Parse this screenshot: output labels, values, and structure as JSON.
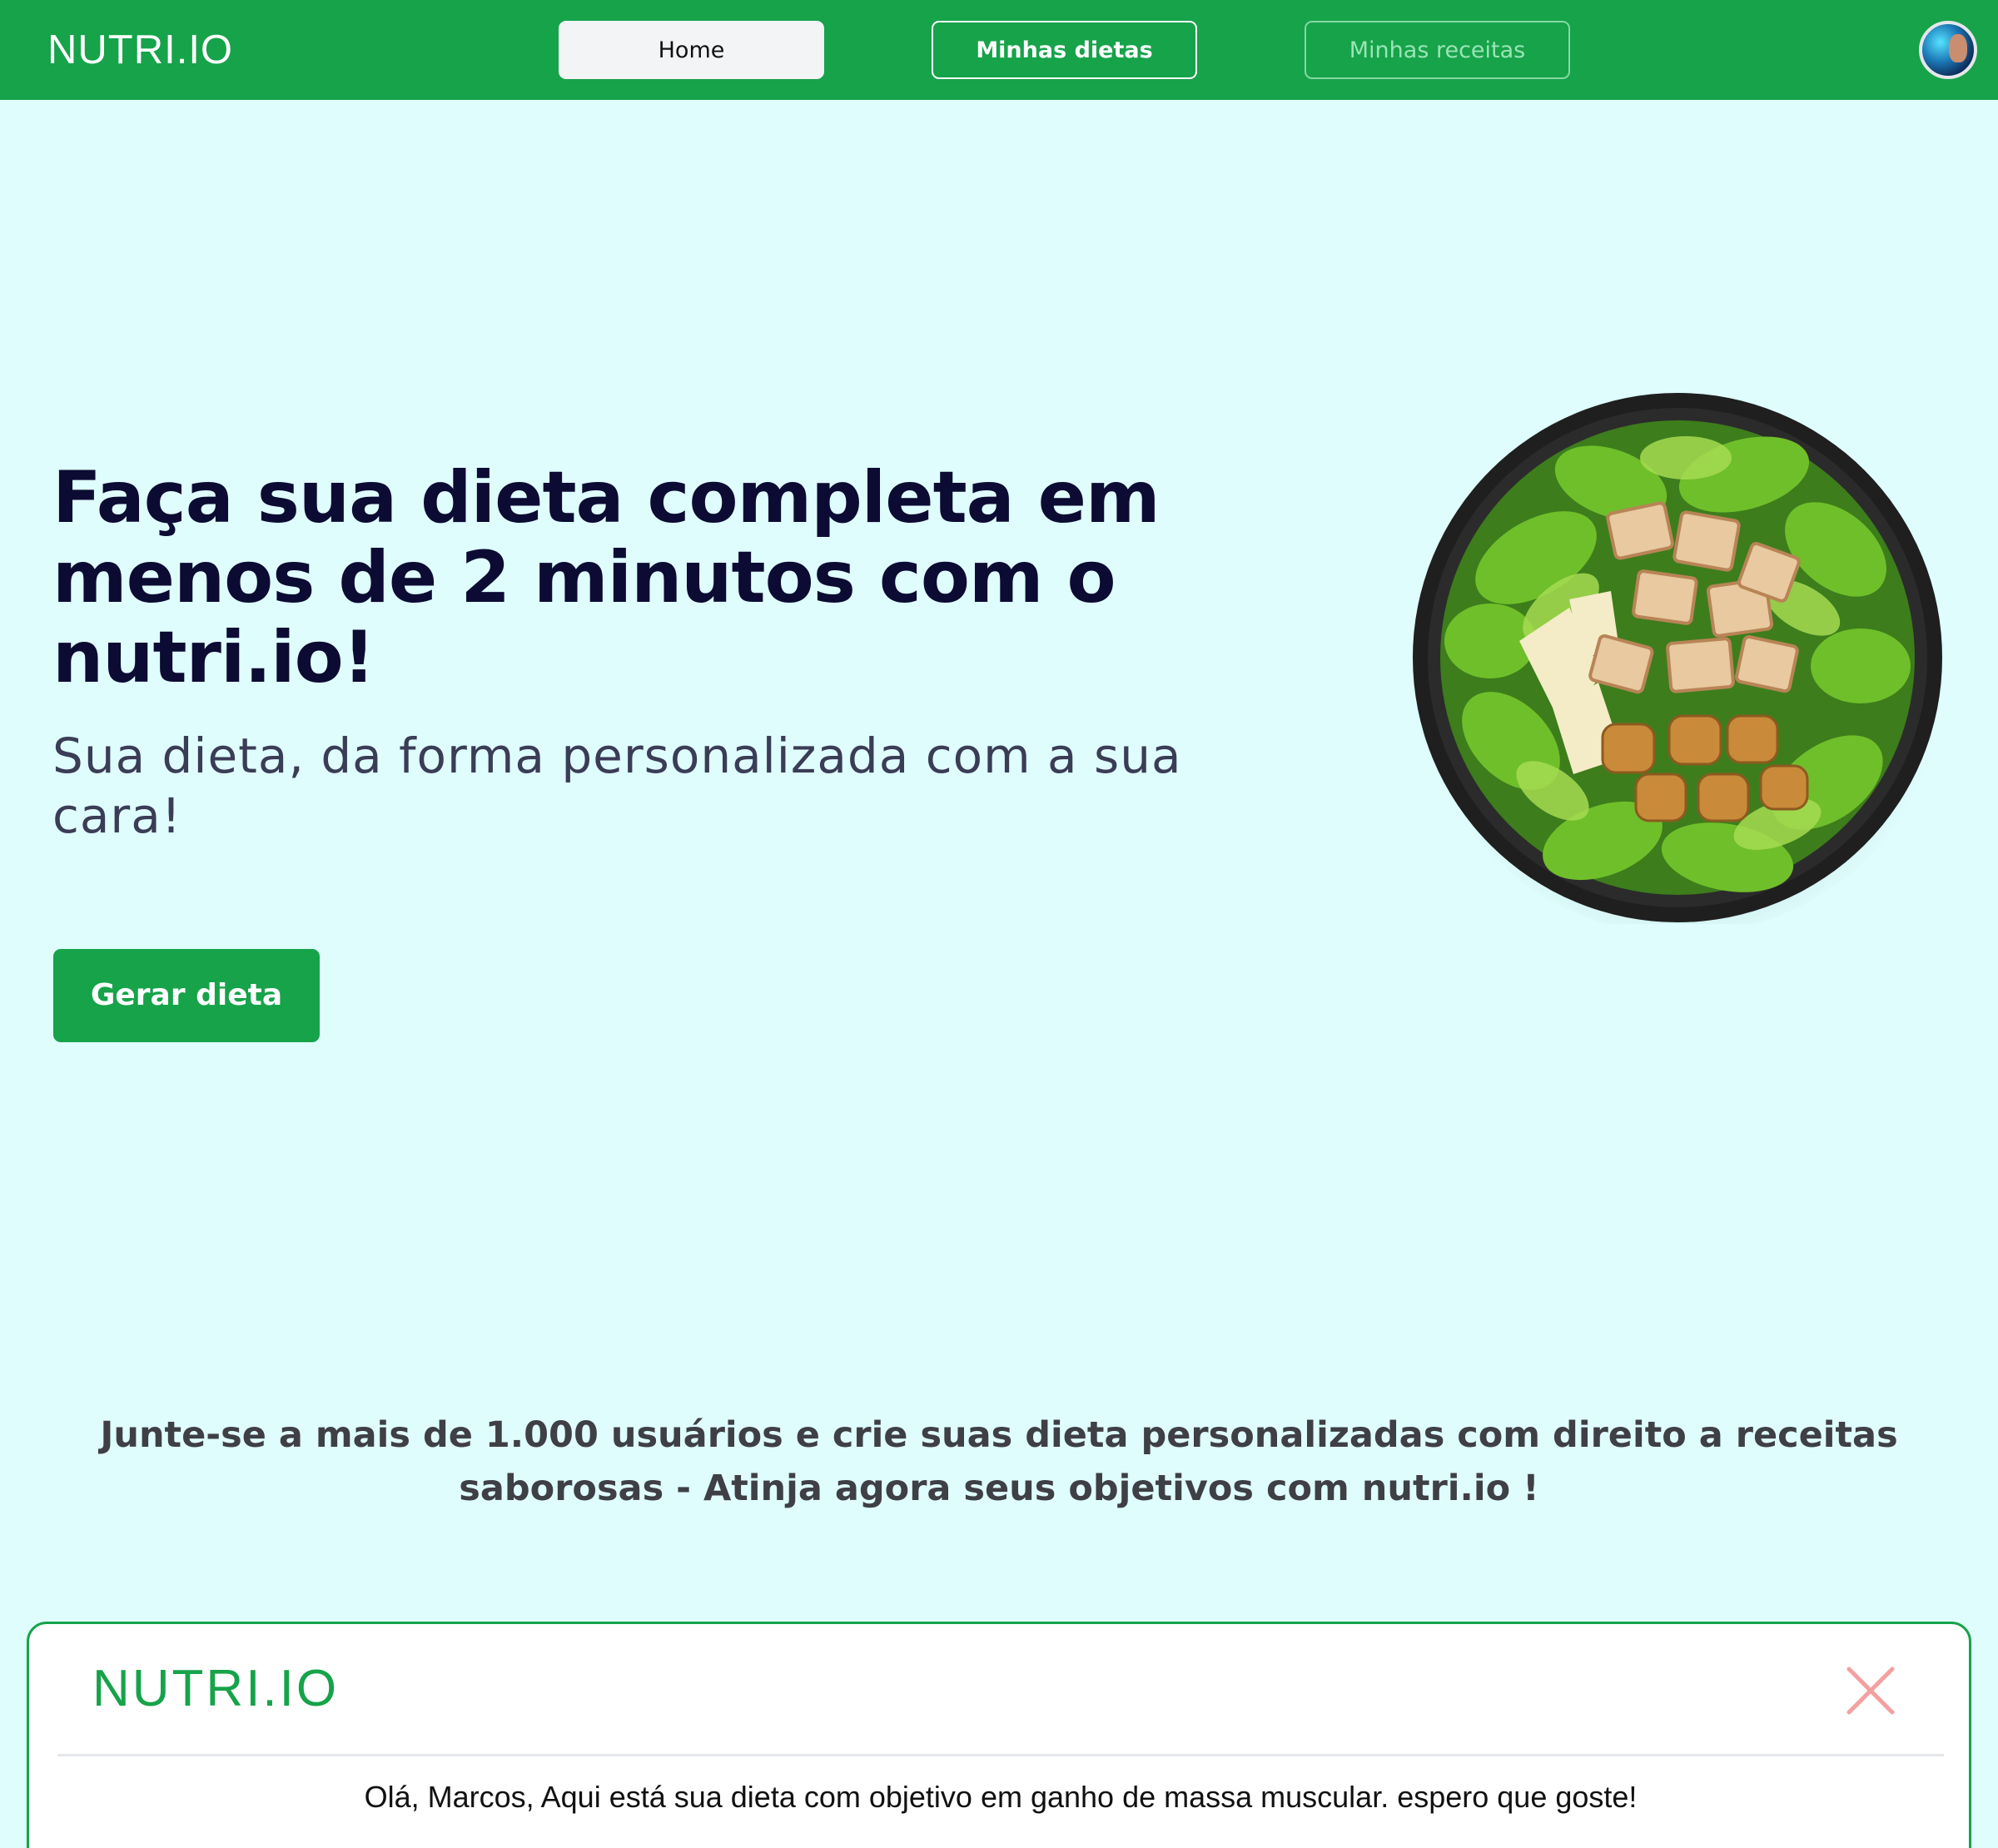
{
  "navbar": {
    "brand": "NUTRI.IO",
    "links": [
      {
        "label": "Home",
        "state": "active"
      },
      {
        "label": "Minhas dietas",
        "state": "outlined"
      },
      {
        "label": "Minhas receitas",
        "state": "disabled"
      }
    ],
    "avatar_icon": "user-avatar"
  },
  "hero": {
    "title": "Faça sua dieta completa em menos de 2 minutos com o nutri.io!",
    "subtitle": "Sua dieta, da forma personalizada com a sua cara!",
    "cta_label": "Gerar dieta",
    "image_icon": "salad-bowl"
  },
  "join_text": "Junte-se a mais de 1.000 usuários e crie suas dieta personalizadas com direito a receitas saborosas - Atinja agora seus objetivos com nutri.io !",
  "modal": {
    "brand": "NUTRI.IO",
    "close_icon": "close-icon",
    "message": "Olá, Marcos, Aqui está sua dieta com objetivo em ganho de massa muscular. espero que goste!"
  },
  "colors": {
    "primary_green": "#16a34a",
    "background": "#dffdfd",
    "heading": "#0c0b33",
    "close_red": "#f4a0a0"
  }
}
